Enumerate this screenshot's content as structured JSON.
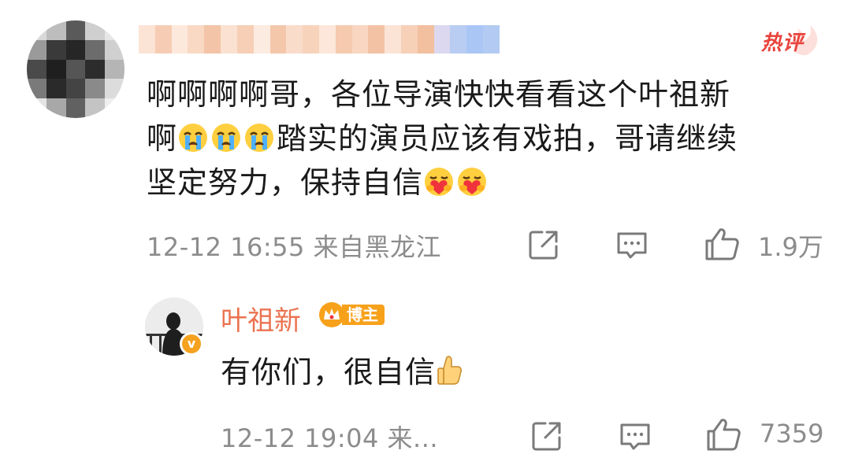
{
  "comment": {
    "hot_tag": "热评",
    "text_line1": "啊啊啊啊哥，各位导演快快看看这个叶祖新",
    "text_line2_start": "啊",
    "text_line2_end": "踏实的演员应该有戏拍，哥请继续",
    "text_line3": "坚定努力，保持自信",
    "emojis": [
      "crying-emoji",
      "crying-emoji",
      "crying-emoji",
      "hug-heart-emoji",
      "hug-heart-emoji"
    ],
    "timestamp": "12-12 16:55 来自黑龙江",
    "like_count": "1.9万"
  },
  "reply": {
    "author": "叶祖新",
    "author_badge": "博主",
    "text": "有你们，很自信",
    "emoji": "thumbs-up-emoji",
    "timestamp": "12-12 19:04 来...",
    "like_count": "7359"
  },
  "colors": {
    "author_name": "#eb7350",
    "hot_tag": "#e8433d",
    "meta_gray": "#8c8c8c",
    "badge_orange": "#f7a11b"
  }
}
